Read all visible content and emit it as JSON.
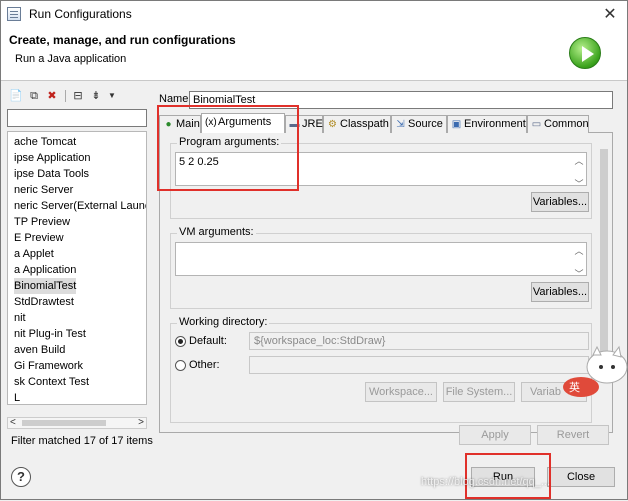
{
  "window": {
    "title": "Run Configurations"
  },
  "header": {
    "title": "Create, manage, and run configurations",
    "subtitle": "Run a Java application"
  },
  "left": {
    "tree_items": [
      "ache Tomcat",
      "ipse Application",
      "ipse Data Tools",
      "neric Server",
      "neric Server(External Launch)",
      "TP Preview",
      "E Preview",
      "a Applet",
      "a Application",
      "BinomialTest",
      "StdDrawtest",
      "nit",
      "nit Plug-in Test",
      "aven Build",
      "Gi Framework",
      "sk Context Test",
      "L"
    ],
    "selected_index": 9,
    "filter_status": "Filter matched 17 of 17 items"
  },
  "right": {
    "name_label": "Name:",
    "name_value": "BinomialTest",
    "tabs": [
      {
        "label": "Main",
        "icon": "main-tab-icon"
      },
      {
        "label": "Arguments",
        "icon": "arguments-tab-icon"
      },
      {
        "label": "JRE",
        "icon": "jre-tab-icon"
      },
      {
        "label": "Classpath",
        "icon": "classpath-tab-icon"
      },
      {
        "label": "Source",
        "icon": "source-tab-icon"
      },
      {
        "label": "Environment",
        "icon": "environment-tab-icon"
      },
      {
        "label": "Common",
        "icon": "common-tab-icon"
      }
    ],
    "active_tab": "Arguments",
    "program_args_label": "Program arguments:",
    "program_args_value": "5 2 0.25",
    "variables_label": "Variables...",
    "vm_args_label": "VM arguments:",
    "vm_args_value": "",
    "working_dir_label": "Working directory:",
    "default_label": "Default:",
    "default_value": "${workspace_loc:StdDraw}",
    "other_label": "Other:",
    "other_value": "",
    "workspace_label": "Workspace...",
    "filesystem_label": "File System...",
    "variables_short": "Variab",
    "apply_label": "Apply",
    "revert_label": "Revert"
  },
  "footer": {
    "help": "?",
    "run_label": "Run",
    "close_label": "Close"
  },
  "overlay": {
    "watermark": "https://blog.csdn.net/qq_...",
    "sticker_text": "英"
  },
  "colors": {
    "highlight": "#e0302a",
    "run_icon": "#3aa21c"
  }
}
